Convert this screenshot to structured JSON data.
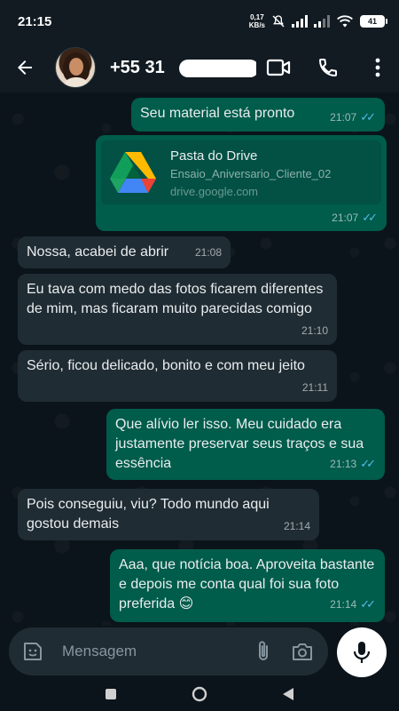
{
  "status_bar": {
    "time": "21:15",
    "net_speed_value": "0,17",
    "net_speed_unit": "KB/s",
    "battery": "41"
  },
  "header": {
    "contact_number": "+55 31",
    "back_icon": "arrow-left-icon",
    "actions": [
      "video-call-icon",
      "phone-icon",
      "more-vert-icon"
    ]
  },
  "messages": [
    {
      "dir": "out",
      "text": "Seu material está pronto",
      "time": "21:07",
      "read": true
    },
    {
      "dir": "out",
      "type": "link-card",
      "title": "Pasta do Drive",
      "subtitle": "Ensaio_Aniversario_Cliente_02",
      "url": "drive.google.com",
      "time": "21:07",
      "read": true
    },
    {
      "dir": "in",
      "text": "Nossa, acabei de abrir",
      "time": "21:08"
    },
    {
      "dir": "in",
      "text": "Eu tava com medo das fotos ficarem diferentes de mim, mas ficaram muito parecidas comigo",
      "time": "21:10"
    },
    {
      "dir": "in",
      "text": "Sério, ficou delicado, bonito e com meu jeito",
      "time": "21:11"
    },
    {
      "dir": "out",
      "text": "Que alívio ler isso. Meu cuidado era justamente preservar seus traços e sua essência",
      "time": "21:13",
      "read": true
    },
    {
      "dir": "in",
      "text": "Pois conseguiu, viu? Todo mundo aqui gostou demais",
      "time": "21:14"
    },
    {
      "dir": "out",
      "text": "Aaa, que notícia boa. Aproveita bastante e depois me conta qual foi sua foto preferida 😊",
      "time": "21:14",
      "read": true
    }
  ],
  "input": {
    "placeholder": "Mensagem"
  },
  "colors": {
    "incoming_bubble": "#202c33",
    "outgoing_bubble": "#005c4b",
    "read_ticks": "#53bdeb",
    "background": "#0b141a"
  }
}
